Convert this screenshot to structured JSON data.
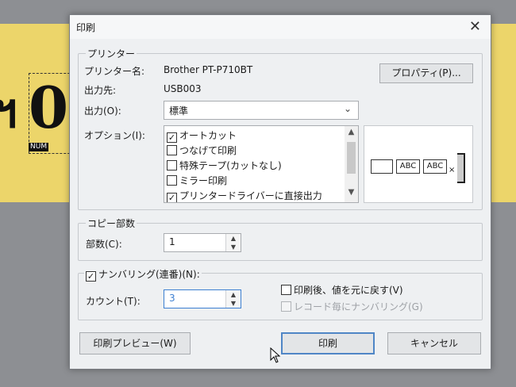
{
  "background": {
    "big_digit": "0",
    "num_tag": "NUM"
  },
  "dialog": {
    "title": "印刷",
    "printer_group": {
      "label": "プリンター",
      "name_label": "プリンター名:",
      "name_value": "Brother PT-P710BT",
      "dest_label": "出力先:",
      "dest_value": "USB003",
      "properties_button": "プロパティ(P)..."
    },
    "output": {
      "label": "出力(O):",
      "selected": "標準"
    },
    "options": {
      "label": "オプション(I):",
      "items": [
        {
          "label": "オートカット",
          "checked": true
        },
        {
          "label": "つなげて印刷",
          "checked": false
        },
        {
          "label": "特殊テープ(カットなし)",
          "checked": false
        },
        {
          "label": "ミラー印刷",
          "checked": false
        },
        {
          "label": "プリンタードライバーに直接出力",
          "checked": true
        }
      ],
      "preview": {
        "labels": [
          "ABC",
          "ABC"
        ],
        "cut_mark": "×"
      }
    },
    "copies": {
      "group_label": "コピー部数",
      "label": "部数(C):",
      "value": "1"
    },
    "numbering": {
      "label": "ナンバリング(連番)(N):",
      "checked": true,
      "count_label": "カウント(T):",
      "count_value": "3",
      "reset_after": "印刷後、値を元に戻す(V)",
      "per_record": "レコード毎にナンバリング(G)"
    },
    "buttons": {
      "preview": "印刷プレビュー(W)",
      "print": "印刷",
      "cancel": "キャンセル"
    }
  }
}
